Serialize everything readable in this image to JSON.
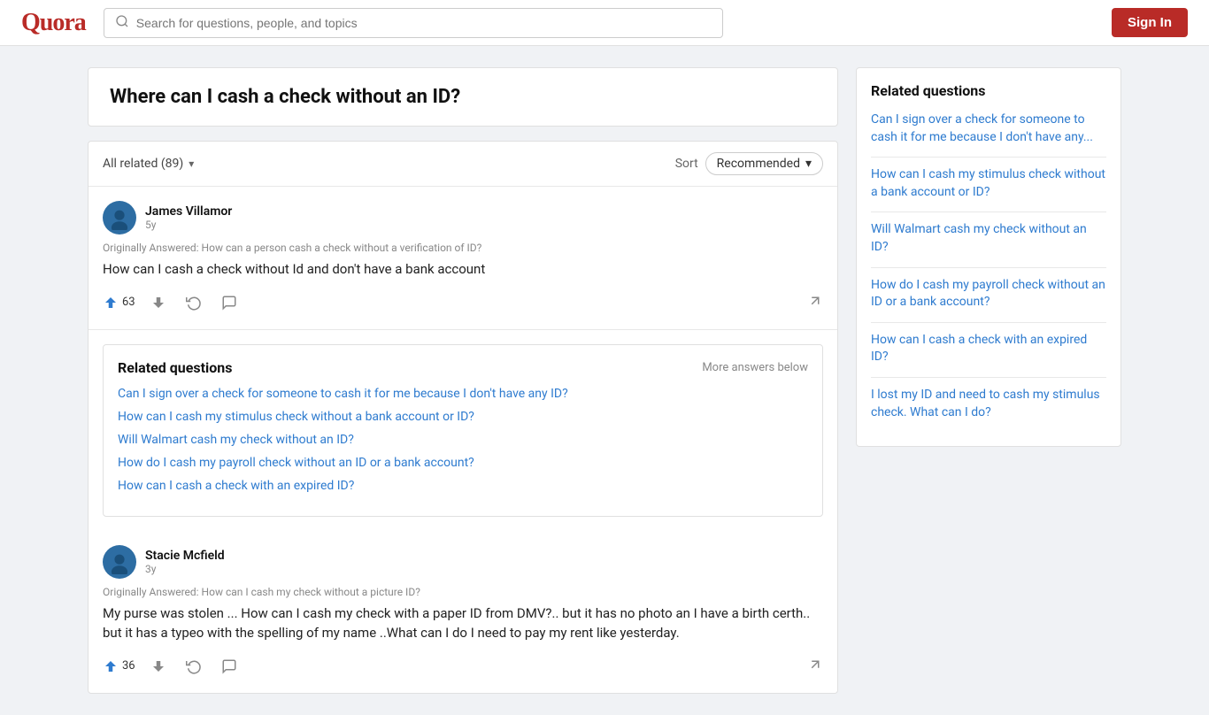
{
  "header": {
    "logo": "Quora",
    "search_placeholder": "Search for questions, people, and topics",
    "sign_in_label": "Sign In"
  },
  "question": {
    "title": "Where can I cash a check without an ID?"
  },
  "filter_bar": {
    "all_related": "All related (89)",
    "sort_label": "Sort",
    "sort_value": "Recommended",
    "chevron": "▾"
  },
  "answers": [
    {
      "author": "James Villamor",
      "time": "5y",
      "originally_answered": "Originally Answered: How can a person cash a check without a verification of ID?",
      "text": "How can I cash a check without Id and don't have a bank account",
      "upvotes": 63,
      "id": "answer-1"
    },
    {
      "author": "Stacie Mcfield",
      "time": "3y",
      "originally_answered": "Originally Answered: How can I cash my check without a picture ID?",
      "text": "My purse was stolen ... How can I cash my check with a paper ID from DMV?.. but it has no photo an I have a birth certh.. but it has a typeo with the spelling of my name ..What can I do I need to pay my rent like yesterday.",
      "upvotes": 36,
      "id": "answer-2"
    }
  ],
  "related_questions_inline": {
    "title": "Related questions",
    "more_label": "More answers below",
    "links": [
      "Can I sign over a check for someone to cash it for me because I don't have any ID?",
      "How can I cash my stimulus check without a bank account or ID?",
      "Will Walmart cash my check without an ID?",
      "How do I cash my payroll check without an ID or a bank account?",
      "How can I cash a check with an expired ID?"
    ]
  },
  "sidebar": {
    "title": "Related questions",
    "links": [
      "Can I sign over a check for someone to cash it for me because I don't have any...",
      "How can I cash my stimulus check without a bank account or ID?",
      "Will Walmart cash my check without an ID?",
      "How do I cash my payroll check without an ID or a bank account?",
      "How can I cash a check with an expired ID?",
      "I lost my ID and need to cash my stimulus check. What can I do?"
    ]
  },
  "icons": {
    "search": "🔍",
    "upvote": "▲",
    "downvote": "▼",
    "retry": "↻",
    "comment": "💬",
    "share": "↗"
  }
}
